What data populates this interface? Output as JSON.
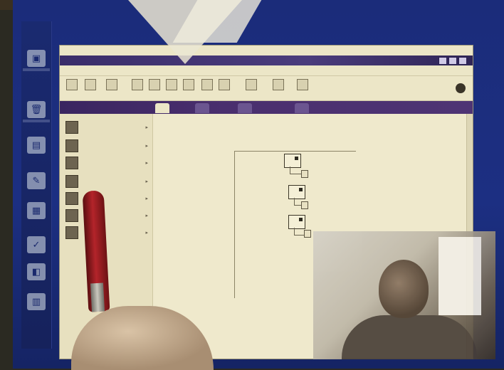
{
  "window": {
    "title": "",
    "menus": [
      "",
      "",
      "",
      "",
      "",
      ""
    ]
  },
  "toolbar": {
    "tools": [
      "",
      "",
      "",
      "",
      "",
      "",
      "",
      "",
      "",
      "",
      "",
      "",
      ""
    ]
  },
  "tabs": {
    "left_title": "",
    "items": [
      "",
      "",
      "",
      ""
    ],
    "active_index": 0
  },
  "panel": {
    "items": [
      {
        "label": "",
        "icon": "document-icon"
      },
      {
        "label": "",
        "icon": "image-icon"
      },
      {
        "label": "",
        "icon": "book-icon"
      },
      {
        "label": "",
        "icon": "page-icon"
      },
      {
        "label": "",
        "icon": "pencil-icon"
      },
      {
        "label": "",
        "icon": "box-icon"
      },
      {
        "label": "",
        "icon": "gear-icon"
      }
    ]
  },
  "canvas": {
    "nodes": [
      {
        "label": ""
      },
      {
        "label": ""
      },
      {
        "label": ""
      }
    ]
  }
}
